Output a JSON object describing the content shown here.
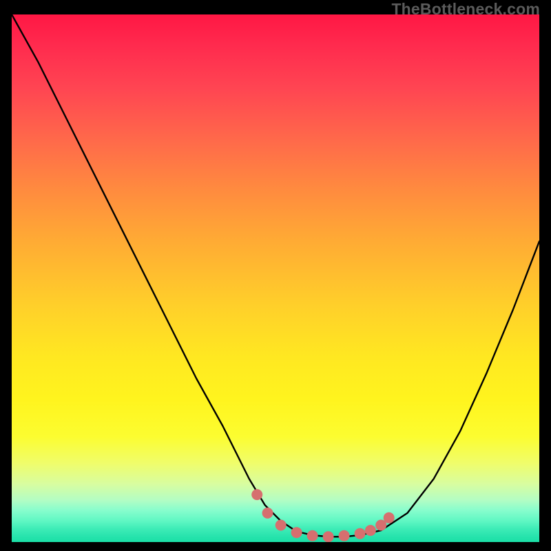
{
  "watermark": "TheBottleneck.com",
  "colors": {
    "frame": "#000000",
    "curve_stroke": "#000000",
    "marker_fill": "#d66f6f",
    "marker_stroke": "#b95858"
  },
  "chart_data": {
    "type": "line",
    "title": "",
    "xlabel": "",
    "ylabel": "",
    "xlim": [
      0,
      100
    ],
    "ylim": [
      0,
      100
    ],
    "series": [
      {
        "name": "bottleneck-curve",
        "x": [
          0,
          5,
          10,
          15,
          20,
          25,
          30,
          35,
          40,
          45,
          48,
          51,
          54,
          57,
          60,
          63,
          66,
          70,
          75,
          80,
          85,
          90,
          95,
          100
        ],
        "y": [
          100,
          91,
          81,
          71,
          61,
          51,
          41,
          31,
          22,
          12,
          7,
          4,
          2,
          1.3,
          1,
          1,
          1.3,
          2.2,
          5.5,
          12,
          21,
          32,
          44,
          57
        ]
      }
    ],
    "markers": [
      {
        "x": 46.5,
        "y": 9.0
      },
      {
        "x": 48.5,
        "y": 5.5
      },
      {
        "x": 51.0,
        "y": 3.2
      },
      {
        "x": 54.0,
        "y": 1.8
      },
      {
        "x": 57.0,
        "y": 1.2
      },
      {
        "x": 60.0,
        "y": 1.0
      },
      {
        "x": 63.0,
        "y": 1.2
      },
      {
        "x": 66.0,
        "y": 1.6
      },
      {
        "x": 68.0,
        "y": 2.2
      },
      {
        "x": 70.0,
        "y": 3.2
      },
      {
        "x": 71.5,
        "y": 4.6
      }
    ],
    "marker_radius_px": 8
  }
}
